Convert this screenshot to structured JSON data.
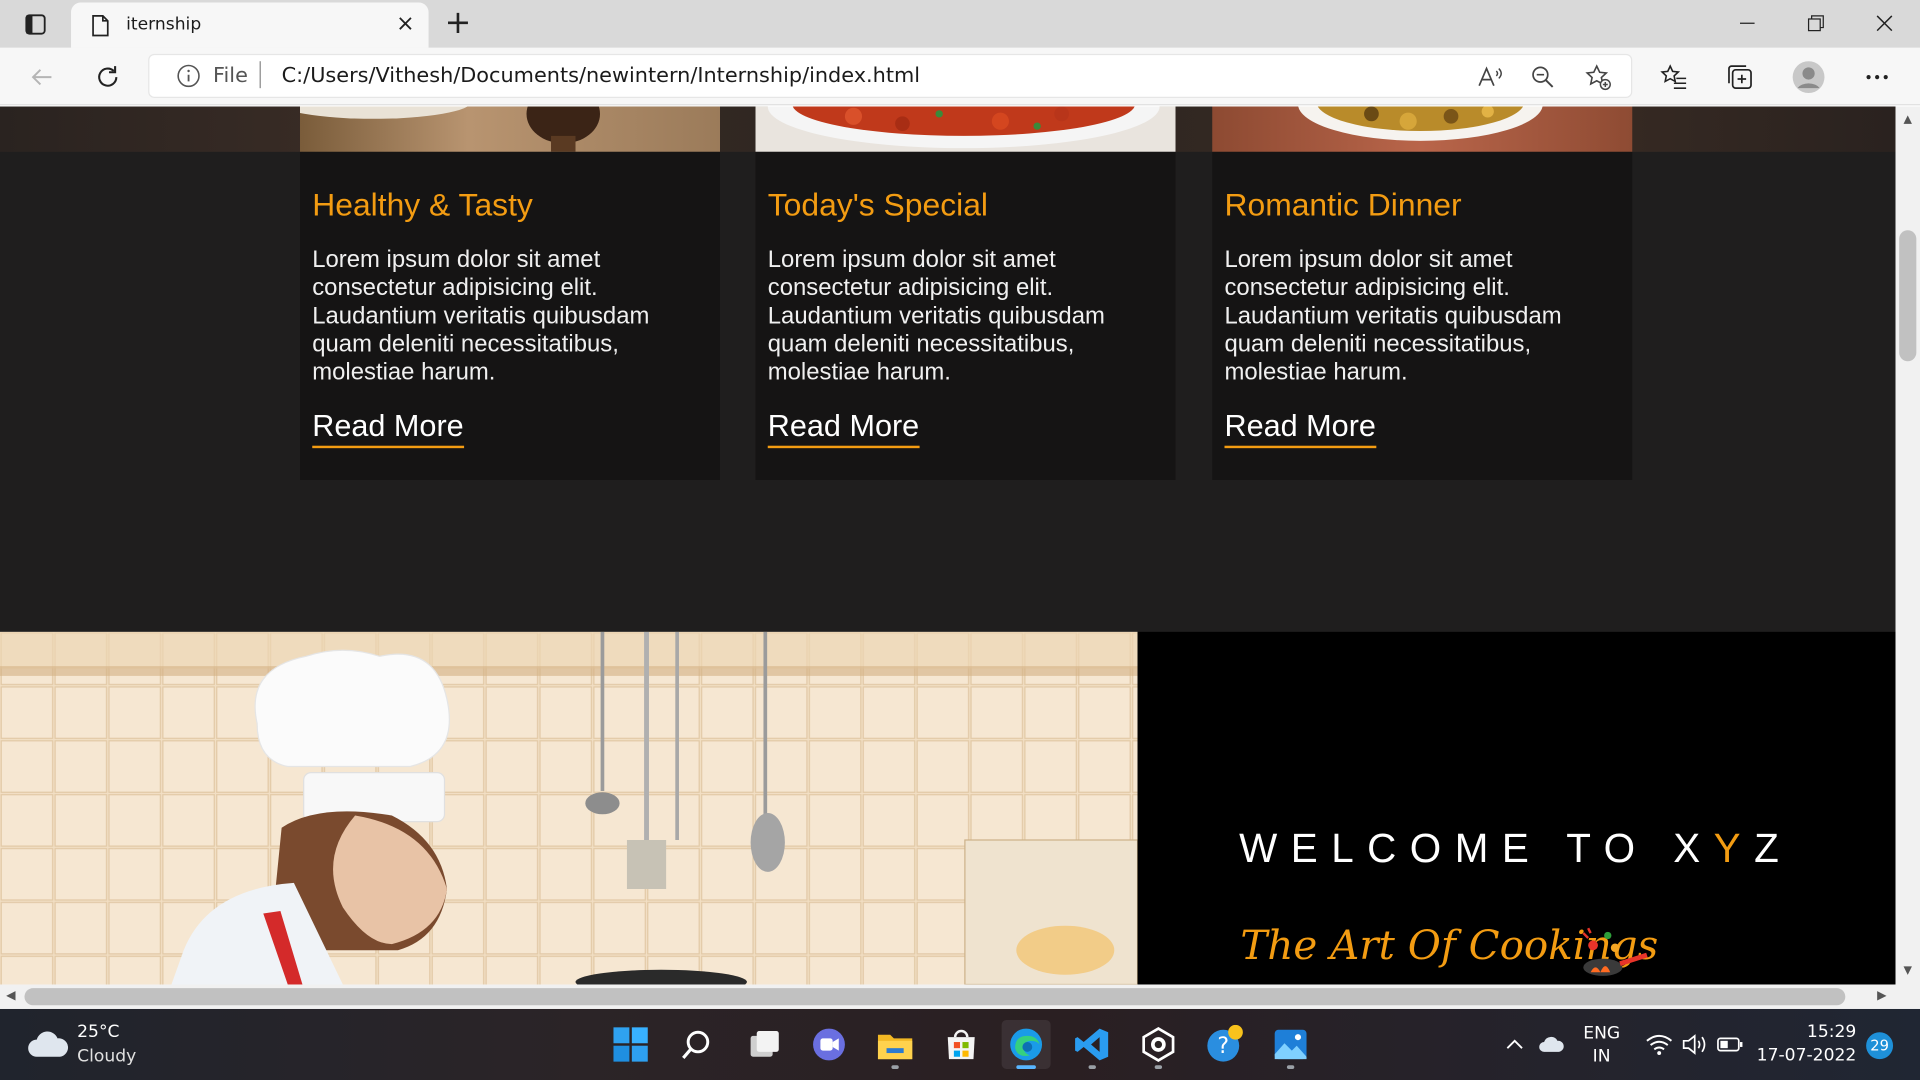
{
  "browser": {
    "tab_title": "iternship",
    "address_scheme": "File",
    "url": "C:/Users/Vithesh/Documents/newintern/Internship/index.html"
  },
  "page": {
    "cards": [
      {
        "title": "Healthy & Tasty",
        "body": "Lorem ipsum dolor sit amet consectetur adipisicing elit. Laudantium veritatis quibusdam quam deleniti necessitatibus, molestiae harum.",
        "link": "Read More"
      },
      {
        "title": "Today's Special",
        "body": "Lorem ipsum dolor sit amet consectetur adipisicing elit. Laudantium veritatis quibusdam quam deleniti necessitatibus, molestiae harum.",
        "link": "Read More"
      },
      {
        "title": "Romantic Dinner",
        "body": "Lorem ipsum dolor sit amet consectetur adipisicing elit. Laudantium veritatis quibusdam quam deleniti necessitatibus, molestiae harum.",
        "link": "Read More"
      }
    ],
    "about": {
      "welcome_prefix": "WELCOME TO X",
      "welcome_highlight": "Y",
      "welcome_suffix": "Z",
      "tagline": "The Art Of Cookings"
    },
    "accent_color": "#f39c12"
  },
  "taskbar": {
    "weather_temp": "25°C",
    "weather_condition": "Cloudy",
    "language_line1": "ENG",
    "language_line2": "IN",
    "time": "15:29",
    "date": "17-07-2022",
    "notification_count": "29"
  }
}
